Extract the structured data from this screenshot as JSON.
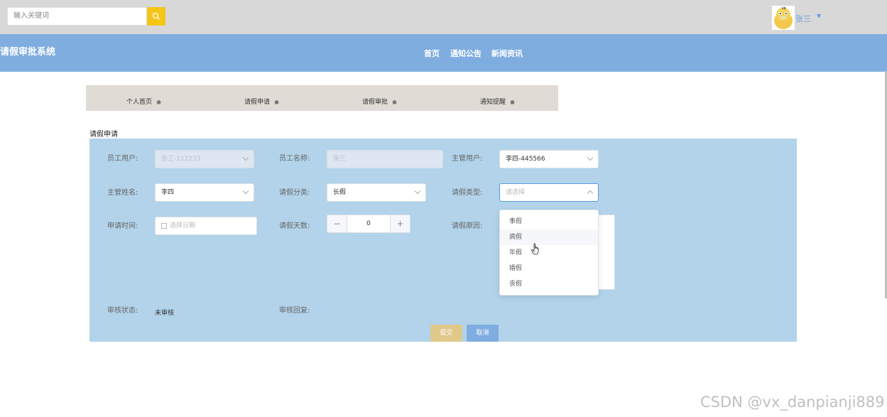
{
  "search": {
    "placeholder": "输入关键词"
  },
  "user": {
    "name": "张三"
  },
  "header": {
    "title": "请假审批系统",
    "nav": [
      "首页",
      "通知公告",
      "新闻资讯"
    ]
  },
  "tabs": [
    "个人首页",
    "请假申请",
    "请假审批",
    "通知提醒"
  ],
  "section_title": "请假申请",
  "form": {
    "employee_user": {
      "label": "员工用户:",
      "value": "张三-112233"
    },
    "employee_name": {
      "label": "员工名称:",
      "value": "张三"
    },
    "manager_user": {
      "label": "主管用户:",
      "value": "李四-445566"
    },
    "manager_name": {
      "label": "主管姓名:",
      "value": "李四"
    },
    "leave_category": {
      "label": "请假分类:",
      "value": "长假"
    },
    "leave_type": {
      "label": "请假类型:",
      "placeholder": "请选择"
    },
    "apply_time": {
      "label": "申请时间:",
      "placeholder": "选择日期"
    },
    "leave_days": {
      "label": "请假天数:",
      "value": "0"
    },
    "leave_reason": {
      "label": "请假原因:"
    },
    "review_status": {
      "label": "审核状态:",
      "value": "未审核"
    },
    "review_reply": {
      "label": "审核回复:"
    },
    "submit_label": "提交",
    "cancel_label": "取消"
  },
  "dropdown_options": [
    "事假",
    "病假",
    "年假",
    "婚假",
    "丧假"
  ],
  "watermark": "CSDN @vx_danpianji889"
}
